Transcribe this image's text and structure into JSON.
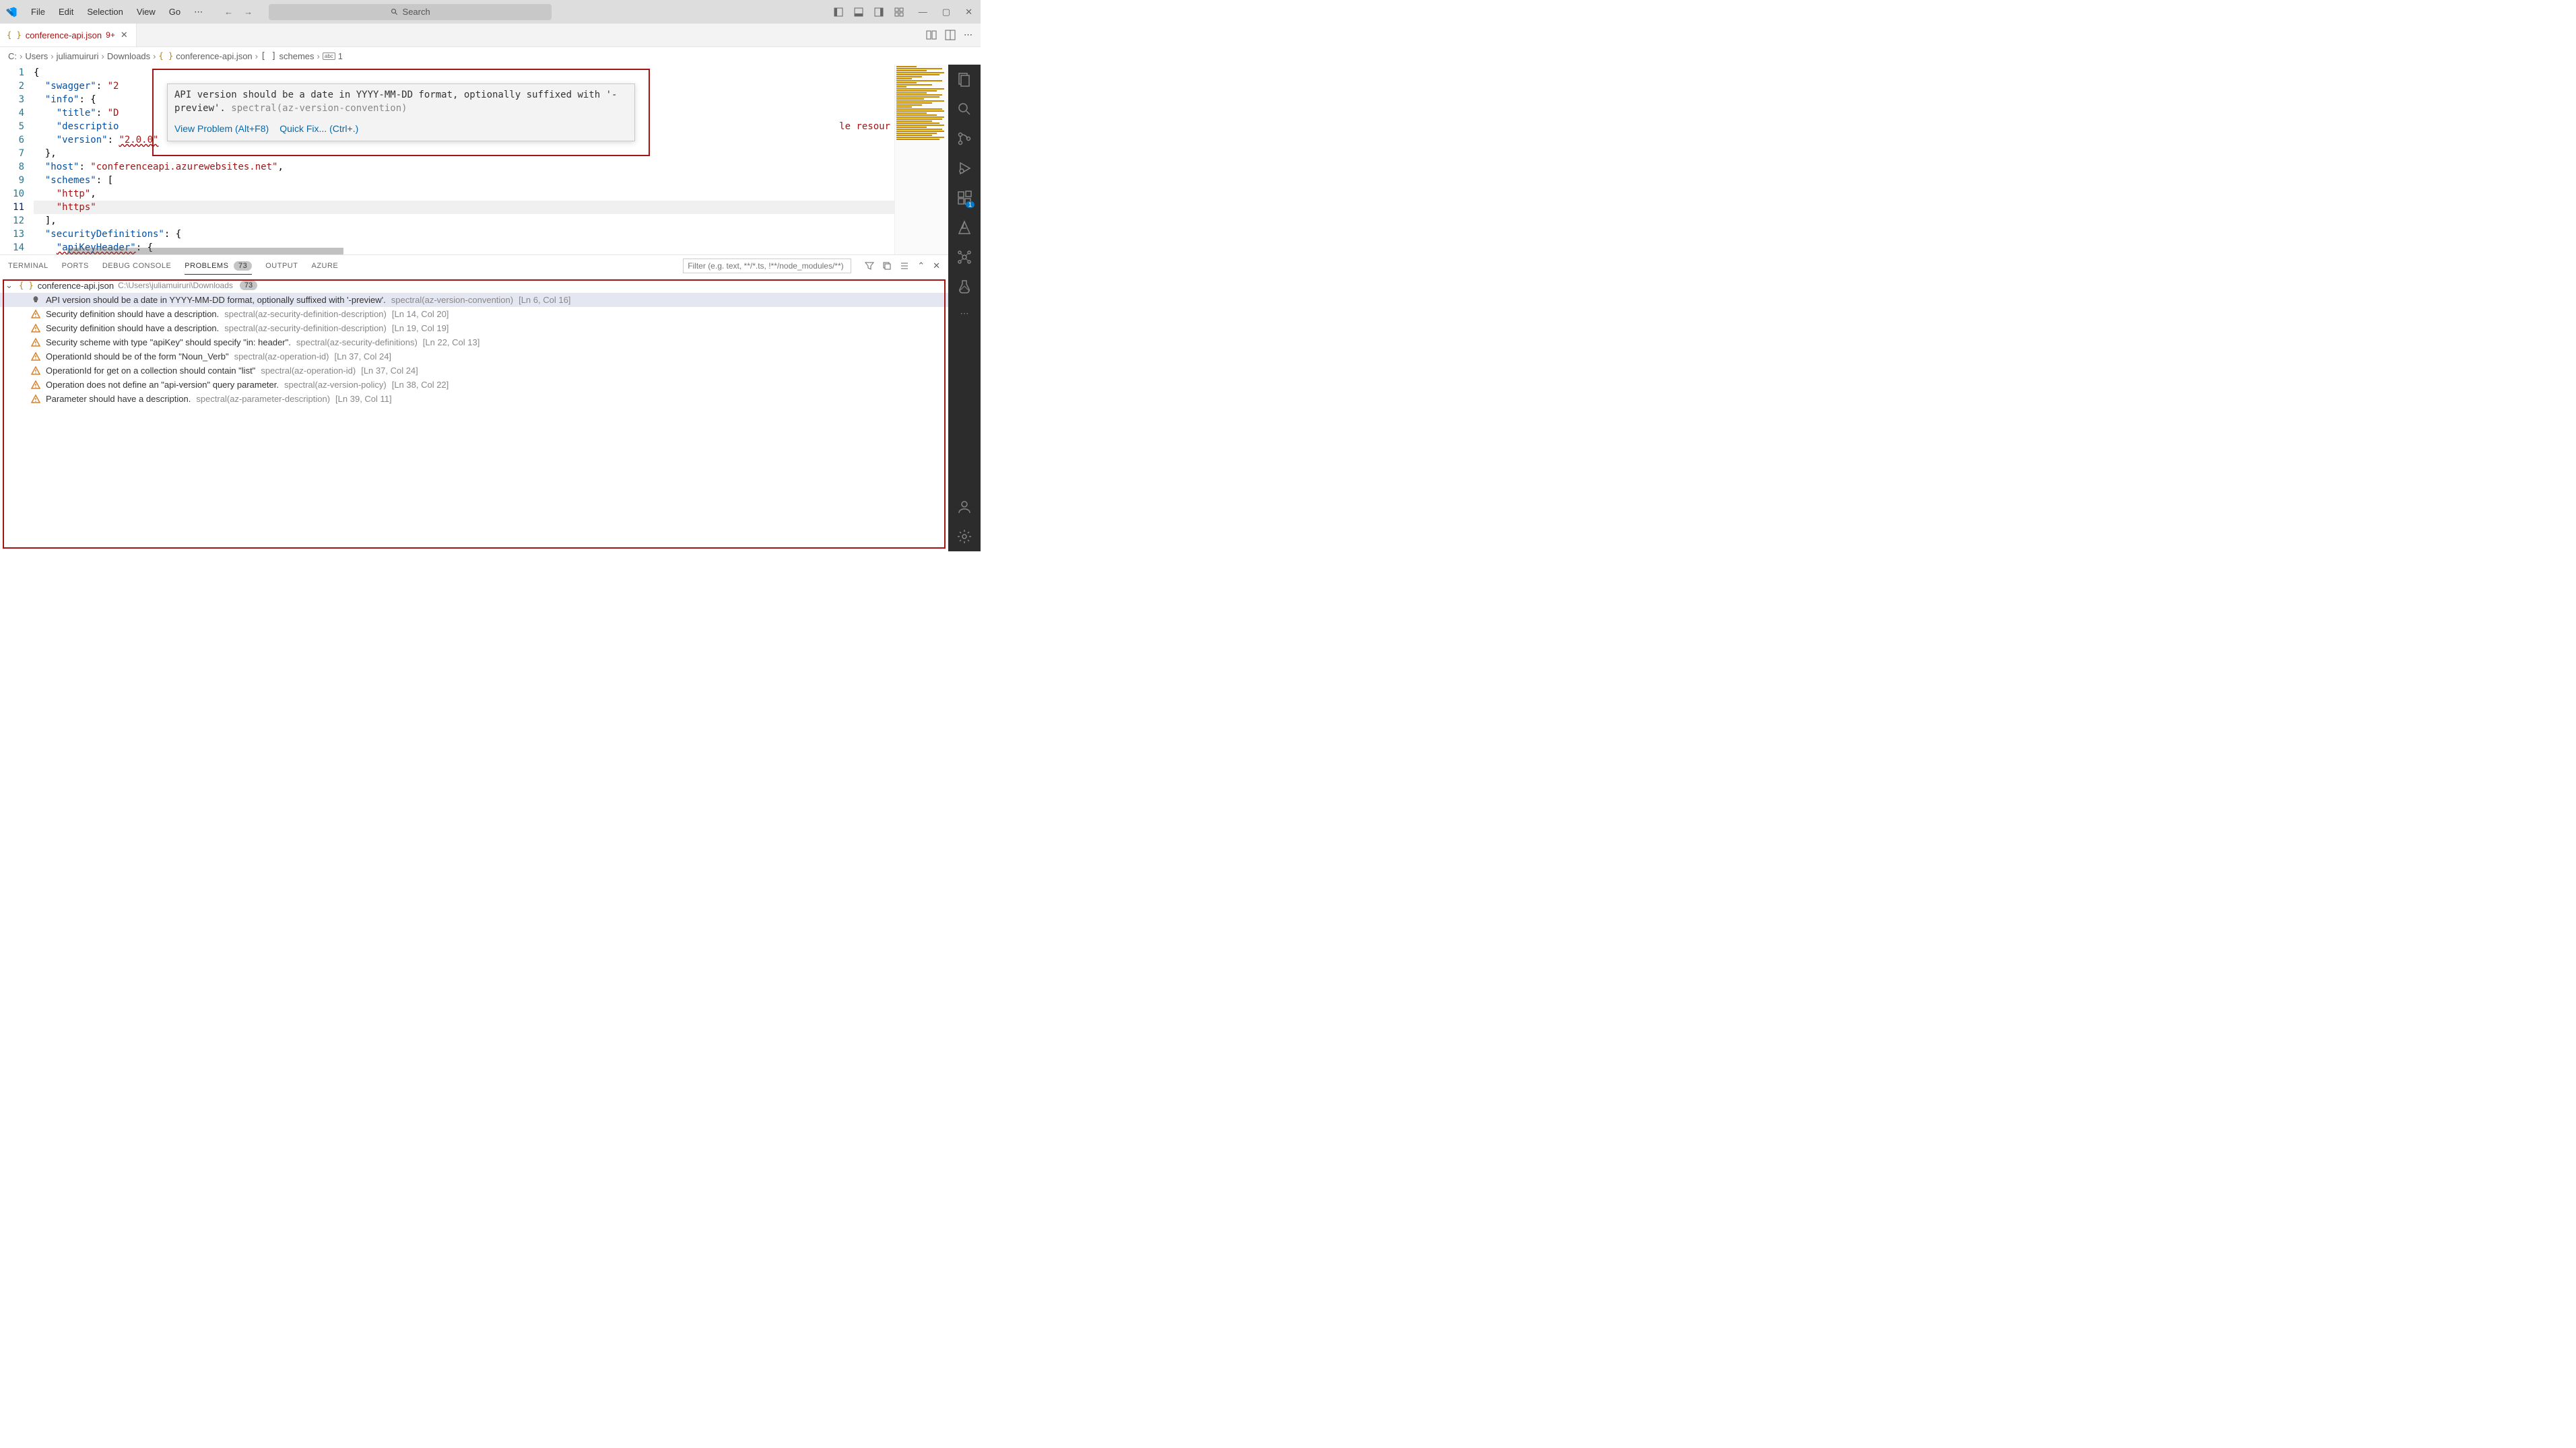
{
  "menu": {
    "file": "File",
    "edit": "Edit",
    "selection": "Selection",
    "view": "View",
    "go": "Go"
  },
  "search": {
    "placeholder": "Search"
  },
  "tab": {
    "name": "conference-api.json",
    "modified_indicator": "9+"
  },
  "breadcrumb": {
    "parts": [
      "C:",
      "Users",
      "juliamuiruri",
      "Downloads",
      "conference-api.json",
      "schemes",
      "1"
    ]
  },
  "code": {
    "lines": [
      {
        "n": 1,
        "text": "{"
      },
      {
        "n": 2,
        "text": "  \"swagger\": \"2"
      },
      {
        "n": 3,
        "text": "  \"info\": {"
      },
      {
        "n": 4,
        "text": "    \"title\": \"D"
      },
      {
        "n": 5,
        "text": "    \"descriptio"
      },
      {
        "n": 6,
        "text": "    \"version\": \"2.0.0\""
      },
      {
        "n": 7,
        "text": "  },"
      },
      {
        "n": 8,
        "text": "  \"host\": \"conferenceapi.azurewebsites.net\","
      },
      {
        "n": 9,
        "text": "  \"schemes\": ["
      },
      {
        "n": 10,
        "text": "    \"http\","
      },
      {
        "n": 11,
        "text": "    \"https\""
      },
      {
        "n": 12,
        "text": "  ],"
      },
      {
        "n": 13,
        "text": "  \"securityDefinitions\": {"
      },
      {
        "n": 14,
        "text": "    \"apiKeyHeader\": {"
      }
    ],
    "active_line": 11,
    "partial_text_right": "le resour"
  },
  "hover": {
    "message": "API version should be a date in YYYY-MM-DD format, optionally suffixed with '-preview'.",
    "source": "spectral(az-version-convention)",
    "link_view": "View Problem (Alt+F8)",
    "link_fix": "Quick Fix... (Ctrl+.)"
  },
  "panel": {
    "tabs": {
      "terminal": "TERMINAL",
      "ports": "PORTS",
      "debug_console": "DEBUG CONSOLE",
      "problems": "PROBLEMS",
      "problems_count": "73",
      "output": "OUTPUT",
      "azure": "AZURE"
    },
    "filter_placeholder": "Filter (e.g. text, **/*.ts, !**/node_modules/**)"
  },
  "problems": {
    "file": {
      "name": "conference-api.json",
      "path": "C:\\Users\\juliamuiruri\\Downloads",
      "count": "73"
    },
    "items": [
      {
        "severity": "info",
        "msg": "API version should be a date in YYYY-MM-DD format, optionally suffixed with '-preview'.",
        "src": "spectral(az-version-convention)",
        "loc": "[Ln 6, Col 16]"
      },
      {
        "severity": "warning",
        "msg": "Security definition should have a description.",
        "src": "spectral(az-security-definition-description)",
        "loc": "[Ln 14, Col 20]"
      },
      {
        "severity": "warning",
        "msg": "Security definition should have a description.",
        "src": "spectral(az-security-definition-description)",
        "loc": "[Ln 19, Col 19]"
      },
      {
        "severity": "warning",
        "msg": "Security scheme with type \"apiKey\" should specify \"in: header\".",
        "src": "spectral(az-security-definitions)",
        "loc": "[Ln 22, Col 13]"
      },
      {
        "severity": "warning",
        "msg": "OperationId should be of the form \"Noun_Verb\"",
        "src": "spectral(az-operation-id)",
        "loc": "[Ln 37, Col 24]"
      },
      {
        "severity": "warning",
        "msg": "OperationId for get on a collection should contain \"list\"",
        "src": "spectral(az-operation-id)",
        "loc": "[Ln 37, Col 24]"
      },
      {
        "severity": "warning",
        "msg": "Operation does not define an \"api-version\" query parameter.",
        "src": "spectral(az-version-policy)",
        "loc": "[Ln 38, Col 22]"
      },
      {
        "severity": "warning",
        "msg": "Parameter should have a description.",
        "src": "spectral(az-parameter-description)",
        "loc": "[Ln 39, Col 11]"
      }
    ]
  },
  "activity": {
    "ext_badge": "1"
  }
}
